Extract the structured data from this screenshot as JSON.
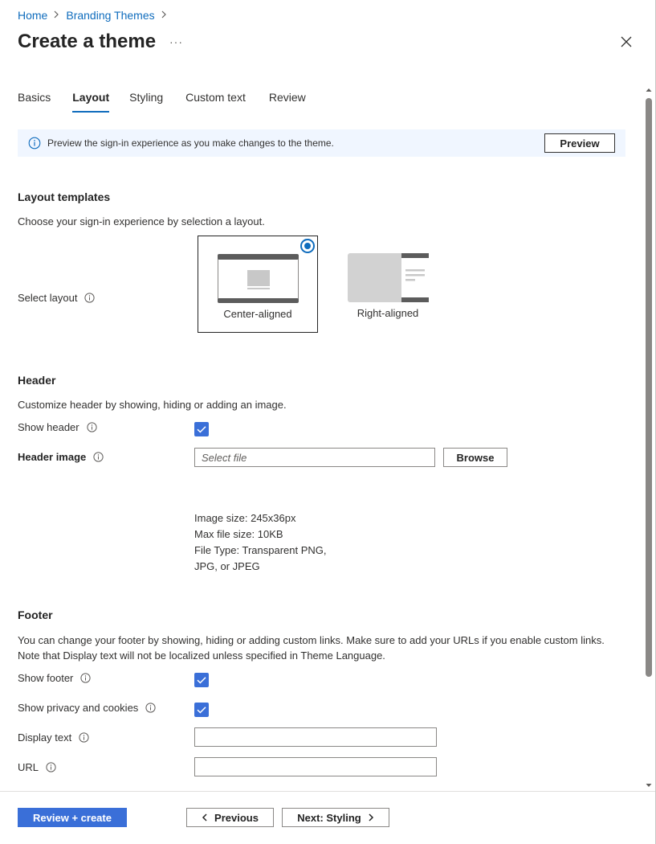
{
  "breadcrumb": {
    "home": "Home",
    "parent": "Branding Themes"
  },
  "title": "Create a theme",
  "more_label": "···",
  "tabs": [
    {
      "label": "Basics"
    },
    {
      "label": "Layout"
    },
    {
      "label": "Styling"
    },
    {
      "label": "Custom text"
    },
    {
      "label": "Review"
    }
  ],
  "active_tab": "Layout",
  "info_bar": {
    "text": "Preview the sign-in experience as you make changes to the theme.",
    "preview_label": "Preview"
  },
  "layout_templates": {
    "title": "Layout templates",
    "description": "Choose your sign-in experience by selection a layout.",
    "select_label": "Select layout",
    "options": [
      {
        "label": "Center-aligned",
        "selected": true
      },
      {
        "label": "Right-aligned",
        "selected": false
      }
    ]
  },
  "header": {
    "title": "Header",
    "description": "Customize header by showing, hiding or adding an image.",
    "show_header_label": "Show header",
    "show_header_checked": true,
    "image_label": "Header image",
    "file_placeholder": "Select file",
    "browse_label": "Browse",
    "specs": [
      "Image size: 245x36px",
      "Max file size: 10KB",
      "File Type: Transparent PNG,",
      "JPG, or JPEG"
    ]
  },
  "footer": {
    "title": "Footer",
    "description_line1": "You can change your footer by showing, hiding or adding custom links. Make sure to add your URLs if you enable custom links.",
    "description_line2": "Note that Display text will not be localized unless specified in Theme Language.",
    "show_footer_label": "Show footer",
    "show_footer_checked": true,
    "privacy_label": "Show privacy and cookies",
    "privacy_checked": true,
    "display_text_label": "Display text",
    "display_text_value": "",
    "url_label": "URL",
    "url_value": ""
  },
  "actions": {
    "review_create": "Review + create",
    "previous": "Previous",
    "next": "Next: Styling"
  },
  "colors": {
    "accent": "#0f6cbd",
    "primary_button": "#3a6fd8",
    "info_bg": "#f0f6ff"
  }
}
